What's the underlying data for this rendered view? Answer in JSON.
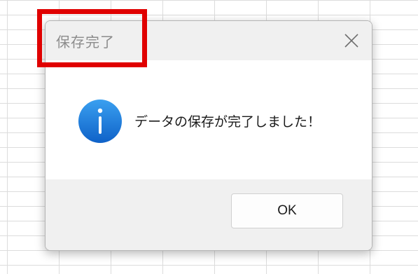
{
  "dialog": {
    "title": "保存完了",
    "message": "データの保存が完了しました！",
    "icon": "info-icon",
    "ok_label": "OK"
  },
  "colors": {
    "highlight": "#e00000",
    "icon_blue": "#1a78d8",
    "title_text": "#8c8c8c"
  }
}
